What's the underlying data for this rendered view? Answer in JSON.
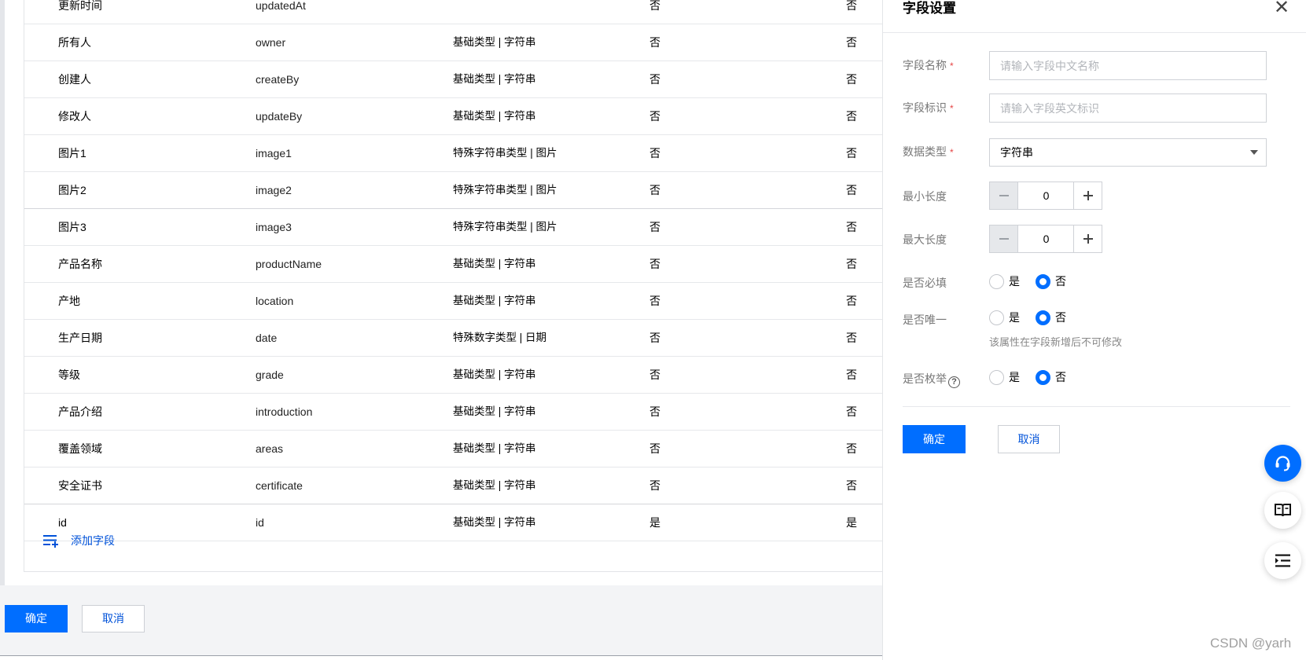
{
  "table": {
    "rows": [
      {
        "name": "更新时间",
        "key": "updatedAt",
        "type": "",
        "required": "否",
        "unique": "否"
      },
      {
        "name": "所有人",
        "key": "owner",
        "type": "基础类型 | 字符串",
        "required": "否",
        "unique": "否"
      },
      {
        "name": "创建人",
        "key": "createBy",
        "type": "基础类型 | 字符串",
        "required": "否",
        "unique": "否"
      },
      {
        "name": "修改人",
        "key": "updateBy",
        "type": "基础类型 | 字符串",
        "required": "否",
        "unique": "否"
      },
      {
        "name": "图片1",
        "key": "image1",
        "type": "特殊字符串类型 | 图片",
        "required": "否",
        "unique": "否"
      },
      {
        "name": "图片2",
        "key": "image2",
        "type": "特殊字符串类型 | 图片",
        "required": "否",
        "unique": "否"
      },
      {
        "name": "图片3",
        "key": "image3",
        "type": "特殊字符串类型 | 图片",
        "required": "否",
        "unique": "否"
      },
      {
        "name": "产品名称",
        "key": "productName",
        "type": "基础类型 | 字符串",
        "required": "否",
        "unique": "否"
      },
      {
        "name": "产地",
        "key": "location",
        "type": "基础类型 | 字符串",
        "required": "否",
        "unique": "否"
      },
      {
        "name": "生产日期",
        "key": "date",
        "type": "特殊数字类型 | 日期",
        "required": "否",
        "unique": "否"
      },
      {
        "name": "等级",
        "key": "grade",
        "type": "基础类型 | 字符串",
        "required": "否",
        "unique": "否"
      },
      {
        "name": "产品介绍",
        "key": "introduction",
        "type": "基础类型 | 字符串",
        "required": "否",
        "unique": "否"
      },
      {
        "name": "覆盖领域",
        "key": "areas",
        "type": "基础类型 | 字符串",
        "required": "否",
        "unique": "否"
      },
      {
        "name": "安全证书",
        "key": "certificate",
        "type": "基础类型 | 字符串",
        "required": "否",
        "unique": "否"
      },
      {
        "name": "id",
        "key": "id",
        "type": "基础类型 | 字符串",
        "required": "是",
        "unique": "是"
      }
    ],
    "add_field_label": "添加字段"
  },
  "footer": {
    "confirm_label": "确定",
    "cancel_label": "取消"
  },
  "drawer": {
    "title": "字段设置",
    "close_glyph": "✕",
    "field_name": {
      "label": "字段名称",
      "required_mark": "*",
      "placeholder": "请输入字段中文名称",
      "value": ""
    },
    "field_key": {
      "label": "字段标识",
      "required_mark": "*",
      "placeholder": "请输入字段英文标识",
      "value": ""
    },
    "data_type": {
      "label": "数据类型",
      "required_mark": "*",
      "value": "字符串"
    },
    "min_length": {
      "label": "最小长度",
      "value": "0"
    },
    "max_length": {
      "label": "最大长度",
      "value": "0"
    },
    "is_required": {
      "label": "是否必填",
      "yes": "是",
      "no": "否",
      "selected": "no"
    },
    "is_unique": {
      "label": "是否唯一",
      "yes": "是",
      "no": "否",
      "selected": "no",
      "hint": "该属性在字段新增后不可修改"
    },
    "is_enum": {
      "label": "是否枚举",
      "help_glyph": "?",
      "yes": "是",
      "no": "否",
      "selected": "no"
    },
    "confirm_label": "确定",
    "cancel_label": "取消"
  },
  "fabs": [
    {
      "icon": "headset-icon"
    },
    {
      "icon": "book-icon"
    },
    {
      "icon": "list-indent-icon"
    }
  ],
  "watermark": "CSDN @yarh",
  "colors": {
    "primary": "#006eff",
    "link": "#0052d9",
    "required": "#e54545"
  }
}
